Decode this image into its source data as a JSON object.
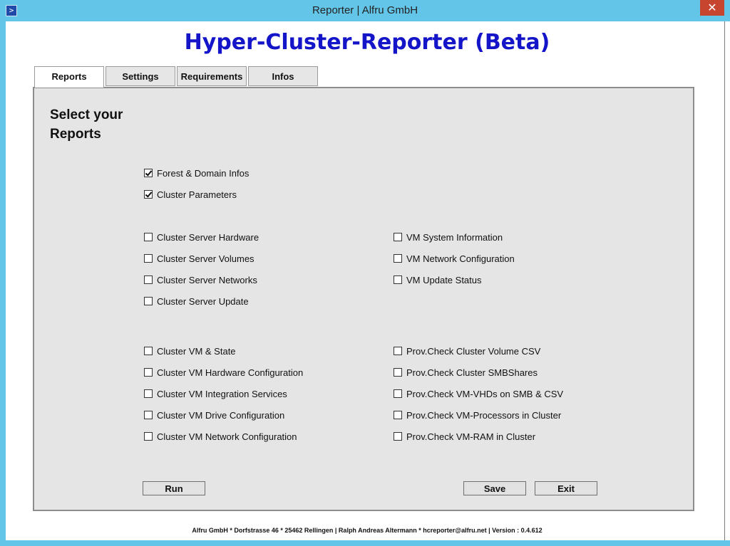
{
  "window": {
    "title": "Reporter | Alfru GmbH",
    "icon": "powershell-icon",
    "close_label": "✕",
    "accent_color": "#63c6e8"
  },
  "header": {
    "title": "Hyper-Cluster-Reporter (Beta)",
    "title_color": "#1414c8"
  },
  "tabs": [
    {
      "label": "Reports",
      "active": true
    },
    {
      "label": "Settings",
      "active": false
    },
    {
      "label": "Requirements",
      "active": false
    },
    {
      "label": "Infos",
      "active": false
    }
  ],
  "reports_panel": {
    "title": "Select your Reports",
    "checkboxes": [
      {
        "label": "Forest & Domain Infos",
        "checked": true
      },
      {
        "label": "Cluster Parameters",
        "checked": true
      },
      {
        "label": "Cluster Server Hardware",
        "checked": false
      },
      {
        "label": "Cluster Server Volumes",
        "checked": false
      },
      {
        "label": "Cluster Server Networks",
        "checked": false
      },
      {
        "label": "Cluster Server Update",
        "checked": false
      },
      {
        "label": "VM System Information",
        "checked": false
      },
      {
        "label": "VM Network Configuration",
        "checked": false
      },
      {
        "label": "VM Update Status",
        "checked": false
      },
      {
        "label": "Cluster VM & State",
        "checked": false
      },
      {
        "label": "Cluster VM Hardware Configuration",
        "checked": false
      },
      {
        "label": "Cluster VM Integration Services",
        "checked": false
      },
      {
        "label": "Cluster VM Drive Configuration",
        "checked": false
      },
      {
        "label": "Cluster VM Network Configuration",
        "checked": false
      },
      {
        "label": "Prov.Check Cluster Volume CSV",
        "checked": false
      },
      {
        "label": "Prov.Check Cluster SMBShares",
        "checked": false
      },
      {
        "label": "Prov.Check VM-VHDs on SMB & CSV",
        "checked": false
      },
      {
        "label": "Prov.Check VM-Processors in Cluster",
        "checked": false
      },
      {
        "label": "Prov.Check VM-RAM in Cluster",
        "checked": false
      }
    ],
    "buttons": {
      "run": "Run",
      "save": "Save",
      "exit": "Exit"
    }
  },
  "footer": {
    "text": "Alfru GmbH * Dorfstrasse 46 * 25462 Rellingen | Ralph Andreas Altermann * hcreporter@alfru.net | Version : 0.4.612"
  }
}
